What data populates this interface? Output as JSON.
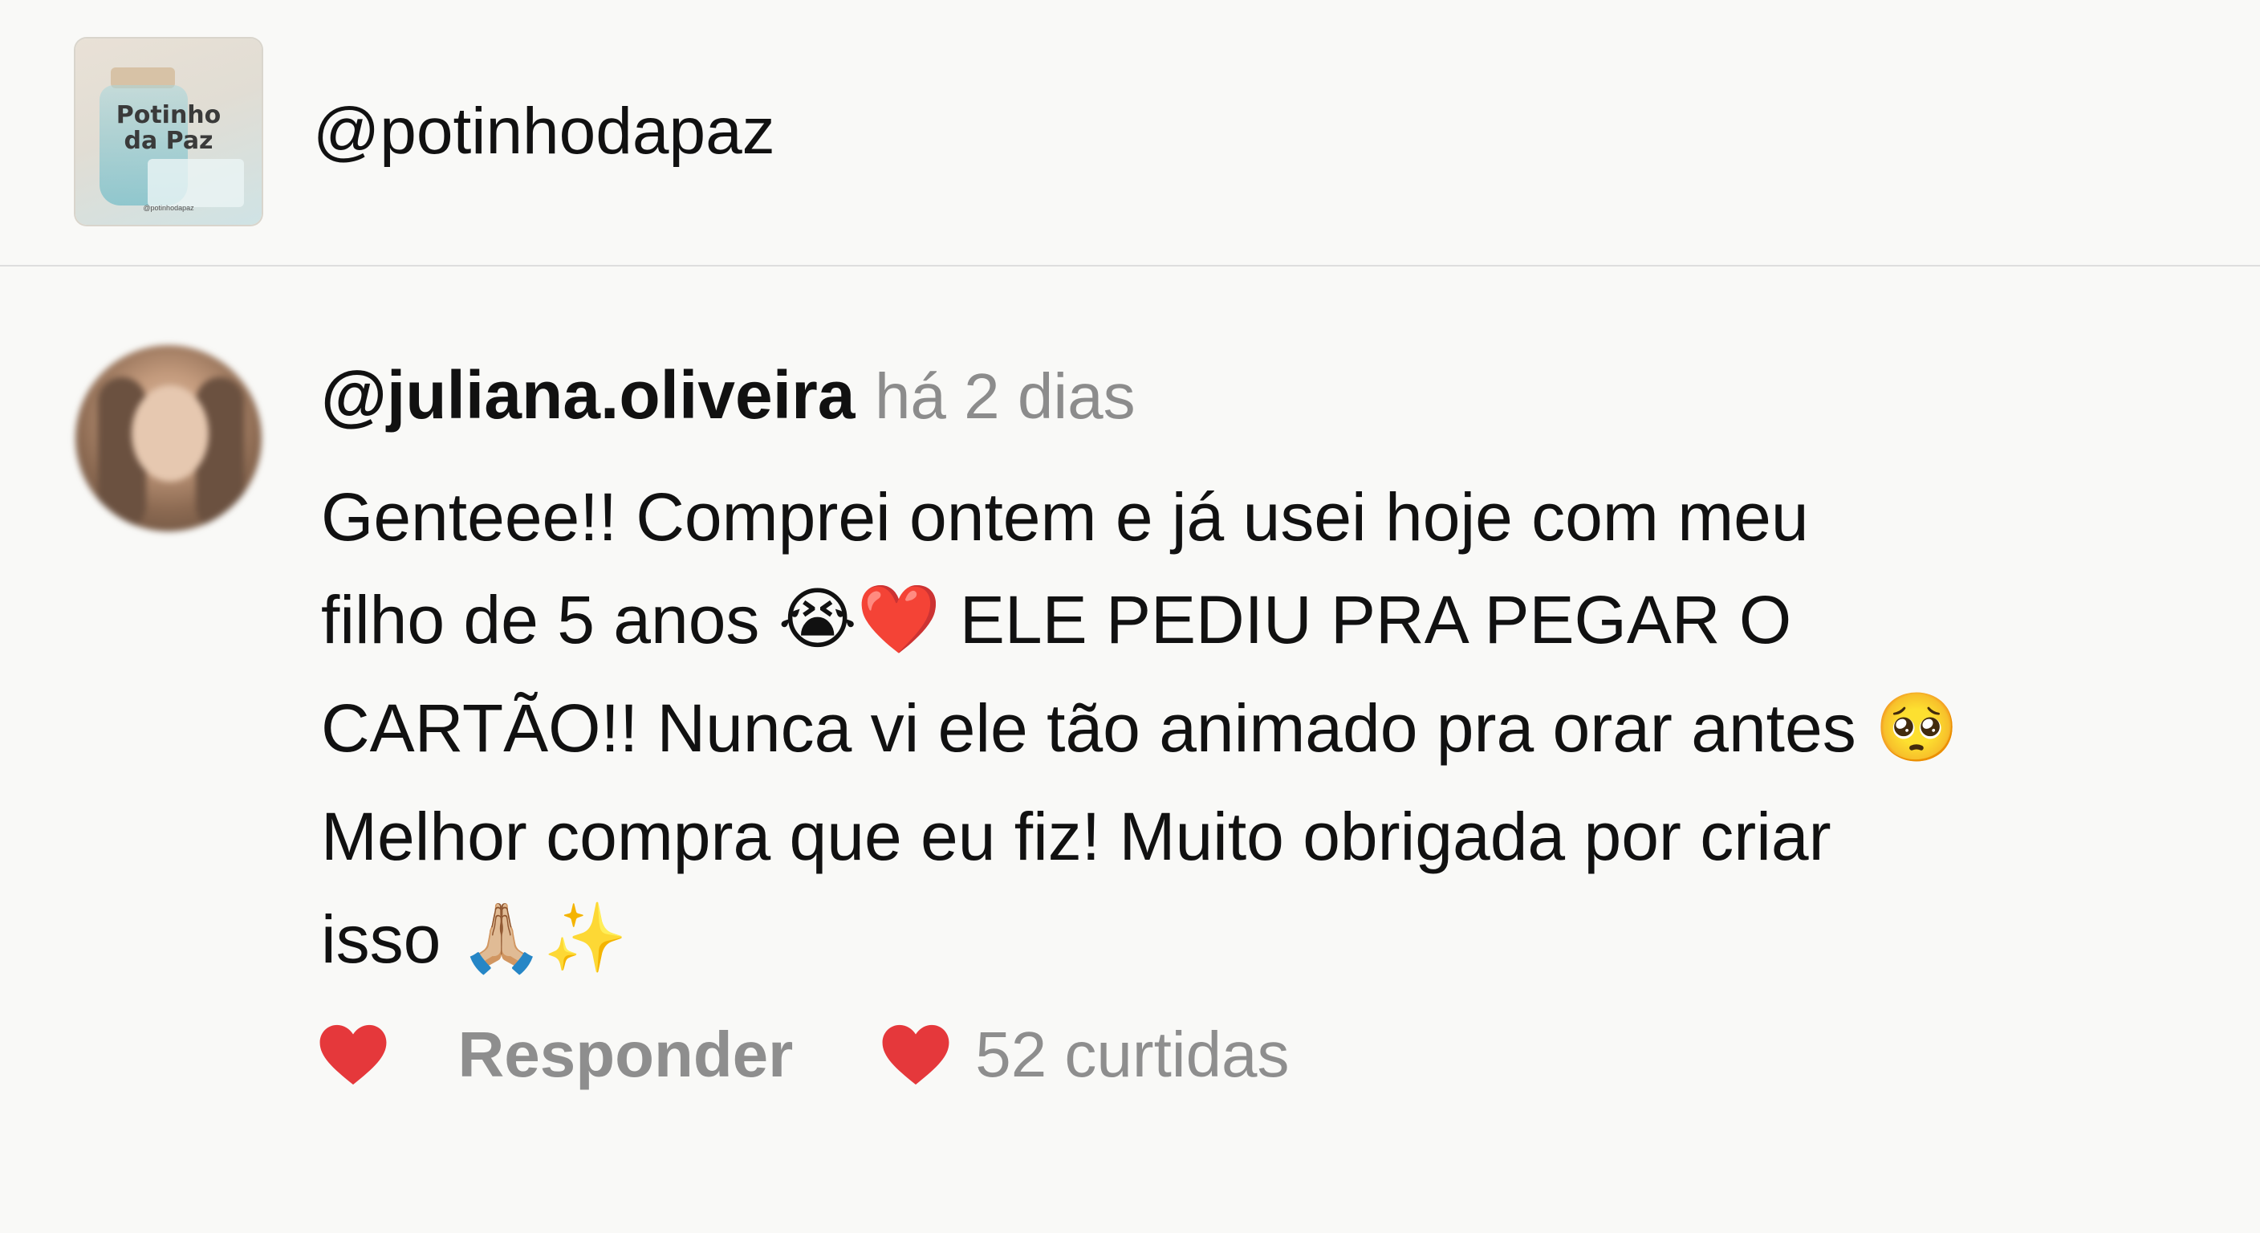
{
  "header": {
    "logo_text_line1": "Potinho",
    "logo_text_line2": "da Paz",
    "logo_small_handle": "@potinhodapaz",
    "handle": "@potinhodapaz"
  },
  "comment": {
    "username": "@juliana.oliveira",
    "timestamp": "há 2 dias",
    "lines": [
      "Genteee!! Comprei ontem e já usei hoje com meu",
      "filho de 5 anos",
      "ELE PEDIU PRA PEGAR O",
      "CARTÃO!! Nunca vi ele tão animado pra orar antes",
      "Melhor compra que eu fiz! Muito obrigada por criar",
      "isso"
    ],
    "emojis": {
      "crying": "😭",
      "heart": "❤️",
      "pleading": "🥺",
      "praying": "🙏🏼",
      "sparkles": "✨"
    }
  },
  "actions": {
    "reply_label": "Responder",
    "likes_label": "52 curtidas",
    "like_color": "#e5383b"
  }
}
